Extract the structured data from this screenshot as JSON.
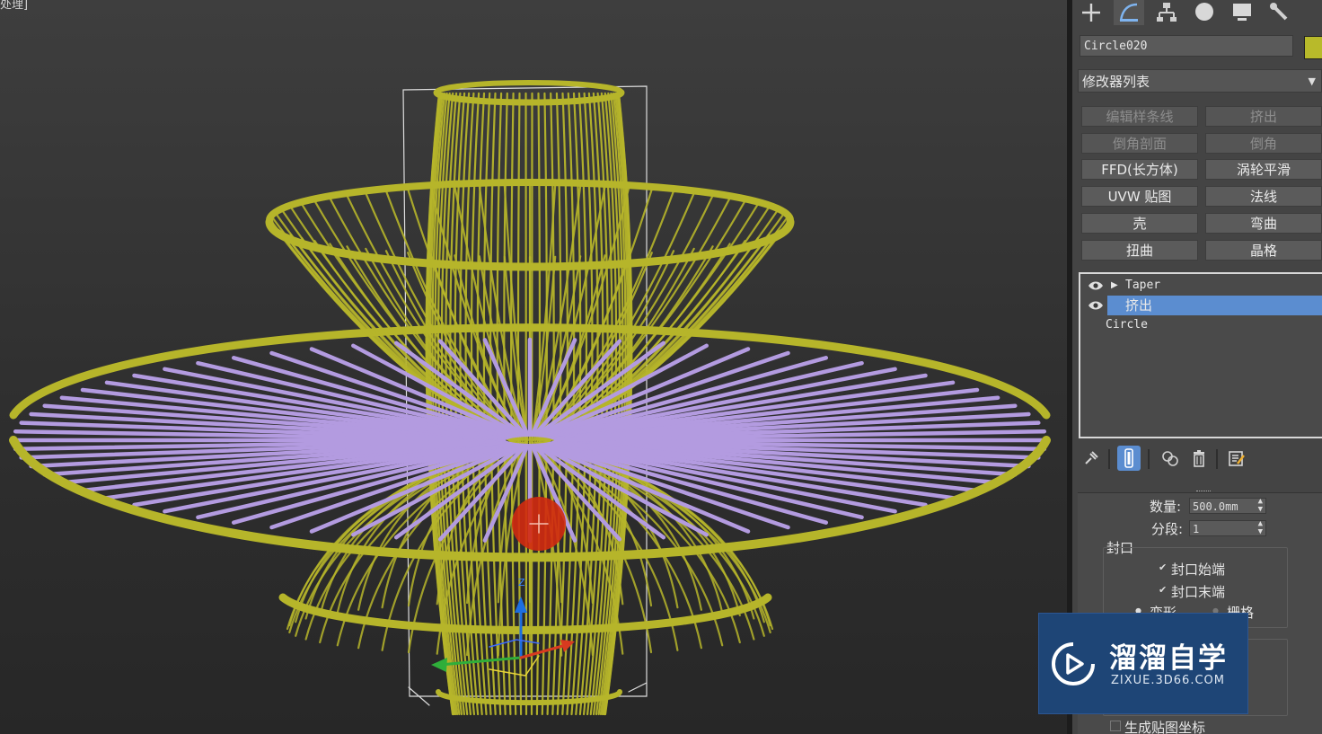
{
  "viewport": {
    "label": "处理]",
    "gizmo_z_label": "Z"
  },
  "command_tabs": [
    {
      "icon": "create-plus-icon"
    },
    {
      "icon": "modify-icon",
      "active": true
    },
    {
      "icon": "hierarchy-icon"
    },
    {
      "icon": "motion-icon"
    },
    {
      "icon": "display-icon"
    },
    {
      "icon": "utilities-wrench-icon"
    }
  ],
  "object": {
    "name": "Circle020",
    "color": "#b8ba2a"
  },
  "modifier_list": {
    "label": "修改器列表"
  },
  "modifier_buttons": [
    {
      "label": "编辑样条线",
      "enabled": false
    },
    {
      "label": "挤出",
      "enabled": false
    },
    {
      "label": "倒角剖面",
      "enabled": false
    },
    {
      "label": "倒角",
      "enabled": false
    },
    {
      "label": "FFD(长方体)",
      "enabled": true
    },
    {
      "label": "涡轮平滑",
      "enabled": true
    },
    {
      "label": "UVW 贴图",
      "enabled": true
    },
    {
      "label": "法线",
      "enabled": true
    },
    {
      "label": "壳",
      "enabled": true
    },
    {
      "label": "弯曲",
      "enabled": true
    },
    {
      "label": "扭曲",
      "enabled": true
    },
    {
      "label": "晶格",
      "enabled": true
    }
  ],
  "modifier_stack": [
    {
      "label": "Taper",
      "eye": true,
      "expander": true,
      "selected": false
    },
    {
      "label": "挤出",
      "eye": true,
      "expander": false,
      "selected": true
    },
    {
      "label": "Circle",
      "eye": false,
      "expander": false,
      "selected": false
    }
  ],
  "stack_tools": [
    {
      "icon": "pin-stack-icon"
    },
    {
      "icon": "show-end-result-icon",
      "active": true
    },
    {
      "icon": "make-unique-icon"
    },
    {
      "icon": "remove-modifier-icon"
    },
    {
      "icon": "configure-modifier-sets-icon"
    }
  ],
  "parameters": {
    "amount_label": "数量:",
    "amount_value": "500.0mm",
    "segments_label": "分段:",
    "segments_value": "1",
    "capping_group": "封口",
    "cap_start_label": "封口始端",
    "cap_start_checked": true,
    "cap_end_label": "封口末端",
    "cap_end_checked": true,
    "morph_label": "变形",
    "grid_label": "栅格",
    "gen_mapping_label": "生成贴图坐标"
  },
  "watermark": {
    "title": "溜溜自学",
    "url": "ZIXUE.3D66.COM"
  },
  "colors": {
    "wire_yellow": "#b6b52a",
    "spoke_purple": "#b39be0",
    "selection_blue": "#5b8dd0",
    "marker_red": "#d12a10"
  }
}
